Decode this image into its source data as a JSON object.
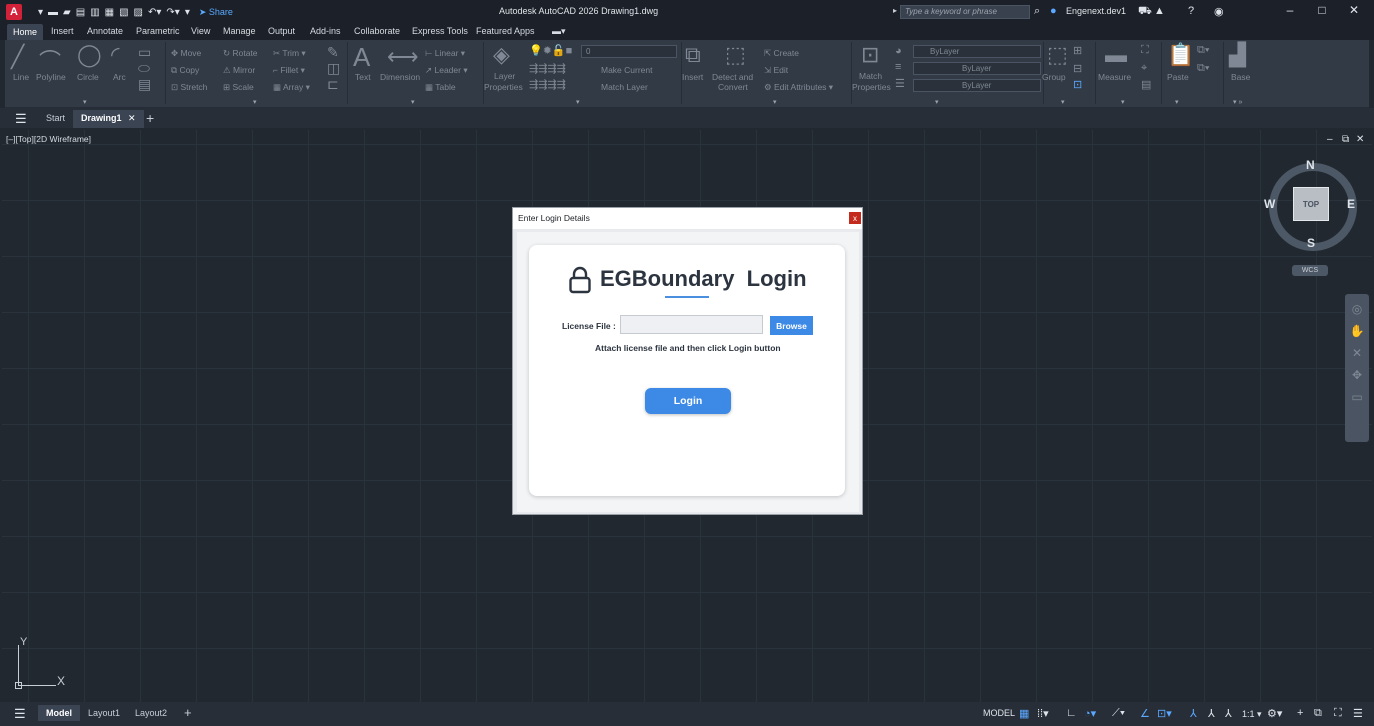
{
  "app": {
    "title": "Autodesk AutoCAD 2026   Drawing1.dwg",
    "app_button": "A",
    "share": "Share",
    "search_placeholder": "Type a keyword or phrase",
    "user": "Engenext.dev1"
  },
  "menu": {
    "tabs": [
      "Home",
      "Insert",
      "Annotate",
      "Parametric",
      "View",
      "Manage",
      "Output",
      "Add-ins",
      "Collaborate",
      "Express Tools",
      "Featured Apps"
    ]
  },
  "ribbon": {
    "draw": [
      "Line",
      "Polyline",
      "Circle",
      "Arc"
    ],
    "modify": [
      "Move",
      "Rotate",
      "Trim",
      "Copy",
      "Mirror",
      "Fillet",
      "Stretch",
      "Scale",
      "Array"
    ],
    "annotation": {
      "text": "Text",
      "dimension": "Dimension",
      "linear": "Linear",
      "leader": "Leader",
      "table": "Table"
    },
    "layers": {
      "layer_properties_1": "Layer",
      "layer_properties_2": "Properties",
      "layer_value": "0",
      "make_current": "Make Current",
      "match_layer": "Match Layer"
    },
    "block": {
      "insert": "Insert",
      "detect_1": "Detect and",
      "detect_2": "Convert",
      "create": "Create",
      "edit": "Edit",
      "edit_attributes": "Edit Attributes"
    },
    "properties": {
      "match_1": "Match",
      "match_2": "Properties",
      "bylayer_1": "ByLayer",
      "bylayer_2": "ByLayer",
      "bylayer_3": "ByLayer"
    },
    "groups": {
      "group": "Group"
    },
    "utilities": {
      "measure": "Measure"
    },
    "clipboard": {
      "paste": "Paste"
    },
    "view": {
      "base": "Base"
    }
  },
  "filetabs": {
    "start": "Start",
    "drawing": "Drawing1"
  },
  "viewport": {
    "label": "[–][Top][2D Wireframe]"
  },
  "viewcube": {
    "n": "N",
    "s": "S",
    "e": "E",
    "w": "W",
    "top": "TOP",
    "wcs": "WCS"
  },
  "ucs": {
    "x": "X",
    "y": "Y"
  },
  "status": {
    "model_tab": "Model",
    "layout1": "Layout1",
    "layout2": "Layout2",
    "model": "MODEL",
    "scale": "1:1"
  },
  "dialog": {
    "title": "Enter Login Details",
    "close": "x",
    "heading": "EGBoundary  Login",
    "license_label": "License File :",
    "license_value": "",
    "browse": "Browse",
    "hint": "Attach license file and then click Login button",
    "login": "Login"
  }
}
